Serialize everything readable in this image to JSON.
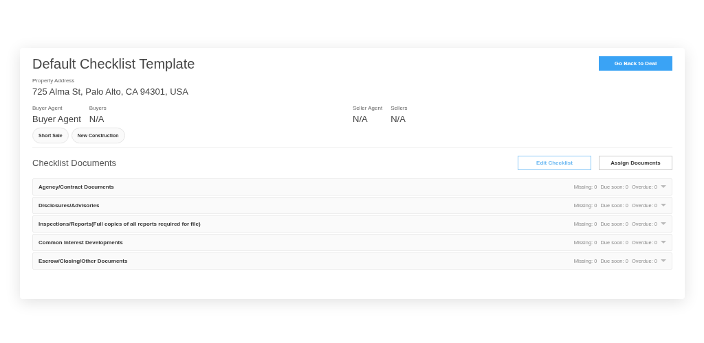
{
  "header": {
    "title": "Default Checklist Template",
    "back_button": "Go Back to Deal"
  },
  "property": {
    "label": "Property Address",
    "value": "725 Alma St, Palo Alto, CA 94301, USA"
  },
  "people": {
    "buyer_side": [
      {
        "label": "Buyer Agent",
        "value": "Buyer Agent"
      },
      {
        "label": "Buyers",
        "value": "N/A"
      }
    ],
    "seller_side": [
      {
        "label": "Seller Agent",
        "value": "N/A"
      },
      {
        "label": "Sellers",
        "value": "N/A"
      }
    ]
  },
  "tags": [
    "Short Sale",
    "New Construction"
  ],
  "checklist": {
    "title": "Checklist Documents",
    "buttons": [
      {
        "label": "Edit Checklist",
        "kind": "outline"
      },
      {
        "label": "Assign Documents",
        "kind": "plain"
      }
    ],
    "sections": [
      {
        "name": "Agency/Contract Documents",
        "missing": "Missing: 0",
        "due_soon": "Due soon: 0",
        "overdue": "Overdue: 0"
      },
      {
        "name": "Disclosures/Advisories",
        "missing": "Missing: 0",
        "due_soon": "Due soon: 0",
        "overdue": "Overdue: 0"
      },
      {
        "name": "Inspections/Reports(Full copies of all reports required for file)",
        "missing": "Missing: 0",
        "due_soon": "Due soon: 0",
        "overdue": "Overdue: 0"
      },
      {
        "name": "Common Interest Developments",
        "missing": "Missing: 0",
        "due_soon": "Due soon: 0",
        "overdue": "Overdue: 0"
      },
      {
        "name": "Escrow/Closing/Other Documents",
        "missing": "Missing: 0",
        "due_soon": "Due soon: 0",
        "overdue": "Overdue: 0"
      }
    ]
  }
}
